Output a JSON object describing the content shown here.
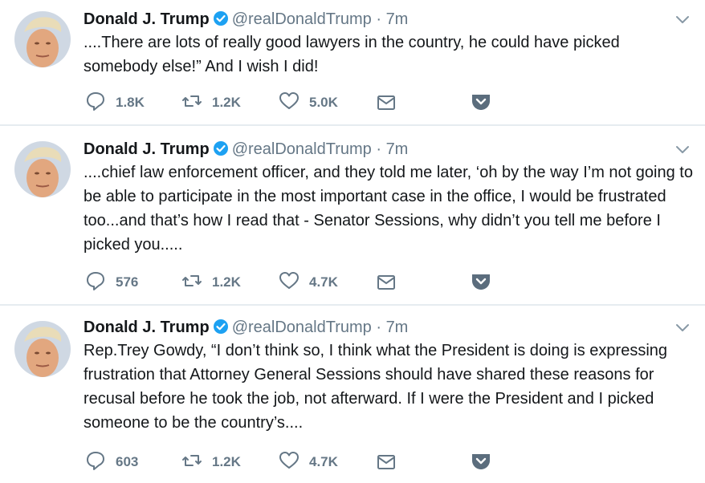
{
  "tweets": [
    {
      "name": "Donald J. Trump",
      "handle": "@realDonaldTrump",
      "separator": "·",
      "time": "7m",
      "text": "....There are lots of really good lawyers in the country, he could have picked somebody else!” And I wish I did!",
      "replies": "1.8K",
      "retweets": "1.2K",
      "likes": "5.0K"
    },
    {
      "name": "Donald J. Trump",
      "handle": "@realDonaldTrump",
      "separator": "·",
      "time": "7m",
      "text": "....chief law enforcement officer, and they told me later, ‘oh by the way I’m not going to be able to participate in the most important case in the office, I would be frustrated too...and that’s how I read that - Senator Sessions, why didn’t you tell me before I picked you.....",
      "replies": "576",
      "retweets": "1.2K",
      "likes": "4.7K"
    },
    {
      "name": "Donald J. Trump",
      "handle": "@realDonaldTrump",
      "separator": "·",
      "time": "7m",
      "text": "Rep.Trey Gowdy, “I don’t think so, I think what the President is doing is expressing frustration that Attorney General Sessions should have shared these reasons for recusal before he took the job, not afterward. If I were the President and I picked someone to be the country’s....",
      "replies": "603",
      "retweets": "1.2K",
      "likes": "4.7K"
    }
  ],
  "icons": {
    "verified": "verified-badge-icon",
    "caret": "chevron-down-icon",
    "reply": "reply-icon",
    "retweet": "retweet-icon",
    "like": "heart-icon",
    "message": "envelope-icon",
    "save": "pocket-save-icon"
  },
  "colors": {
    "verified_blue": "#1da1f2",
    "action_gray": "#657786",
    "separator": "#e6ecf0",
    "pocket": "#5b6d7d"
  }
}
